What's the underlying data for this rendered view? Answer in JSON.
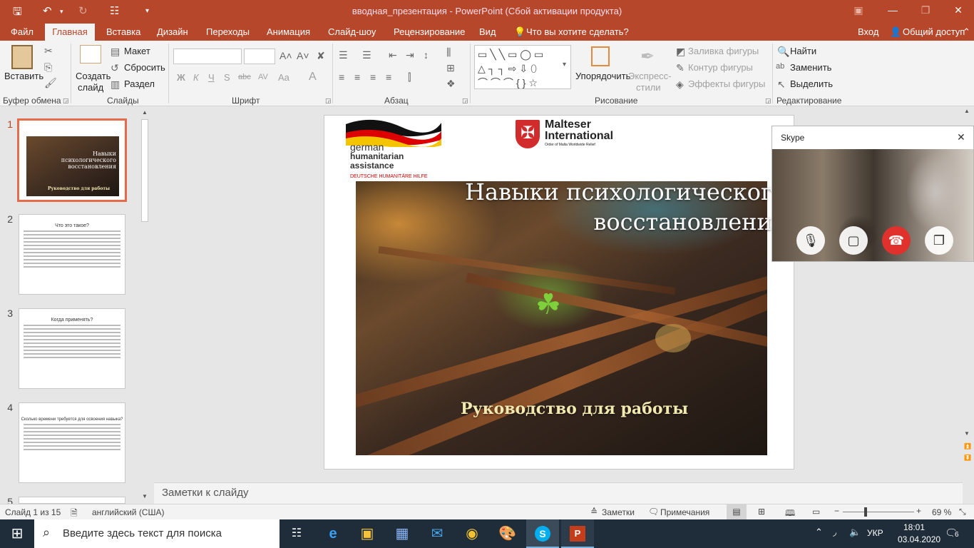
{
  "window": {
    "title": "вводная_презентация - PowerPoint (Сбой активации продукта)"
  },
  "tabs": [
    "Файл",
    "Главная",
    "Вставка",
    "Дизайн",
    "Переходы",
    "Анимация",
    "Слайд-шоу",
    "Рецензирование",
    "Вид"
  ],
  "tell_me": "Что вы хотите сделать?",
  "signin": "Вход",
  "share": "Общий доступ",
  "ribbon": {
    "groups": {
      "clipboard": "Буфер обмена",
      "slides": "Слайды",
      "font": "Шрифт",
      "paragraph": "Абзац",
      "drawing": "Рисование",
      "editing": "Редактирование"
    },
    "paste": "Вставить",
    "new_slide_1": "Создать",
    "new_slide_2": "слайд",
    "layout": "Макет",
    "reset": "Сбросить",
    "section": "Раздел",
    "font_buttons": {
      "bold": "Ж",
      "italic": "К",
      "underline": "Ч",
      "shadow": "S",
      "strike": "abc",
      "spacing": "AV",
      "case": "Aa",
      "color": "A"
    },
    "arrange": "Упорядочить",
    "quick_styles_1": "Экспресс-",
    "quick_styles_2": "стили",
    "shape_fill": "Заливка фигуры",
    "shape_outline": "Контур фигуры",
    "shape_effects": "Эффекты фигуры",
    "find": "Найти",
    "replace": "Заменить",
    "select": "Выделить"
  },
  "thumbs": [
    {
      "num": "1",
      "title": "Навыки психологического восстановления",
      "sub": "Руководство для работы"
    },
    {
      "num": "2",
      "title": "Что это такое?"
    },
    {
      "num": "3",
      "title": "Когда применять?"
    },
    {
      "num": "4",
      "title": "Сколько времени требуется для освоения навыка?"
    },
    {
      "num": "5"
    }
  ],
  "slide": {
    "logo_left": {
      "line1": "german",
      "line2": "humanitarian",
      "line3": "assistance",
      "line4": "DEUTSCHE HUMANITÄRE HILFE"
    },
    "logo_right": {
      "line1": "Malteser",
      "line2": "International",
      "line3": "Order of Malta Worldwide Relief"
    },
    "title_line1": "Навыки психологического",
    "title_line2": "восстановления",
    "subtitle": "Руководство для работы"
  },
  "notes_placeholder": "Заметки к слайду",
  "status": {
    "slide": "Слайд 1 из 15",
    "lang": "английский (США)",
    "notes": "Заметки",
    "comments": "Примечания",
    "zoom": "69 %"
  },
  "skype": {
    "title": "Skype"
  },
  "taskbar": {
    "search": "Введите здесь текст для поиска",
    "lang": "УКР",
    "time": "18:01",
    "date": "03.04.2020",
    "badge": "6"
  },
  "colors": {
    "accent": "#b7472a",
    "taskbar": "#1f2d3a"
  }
}
